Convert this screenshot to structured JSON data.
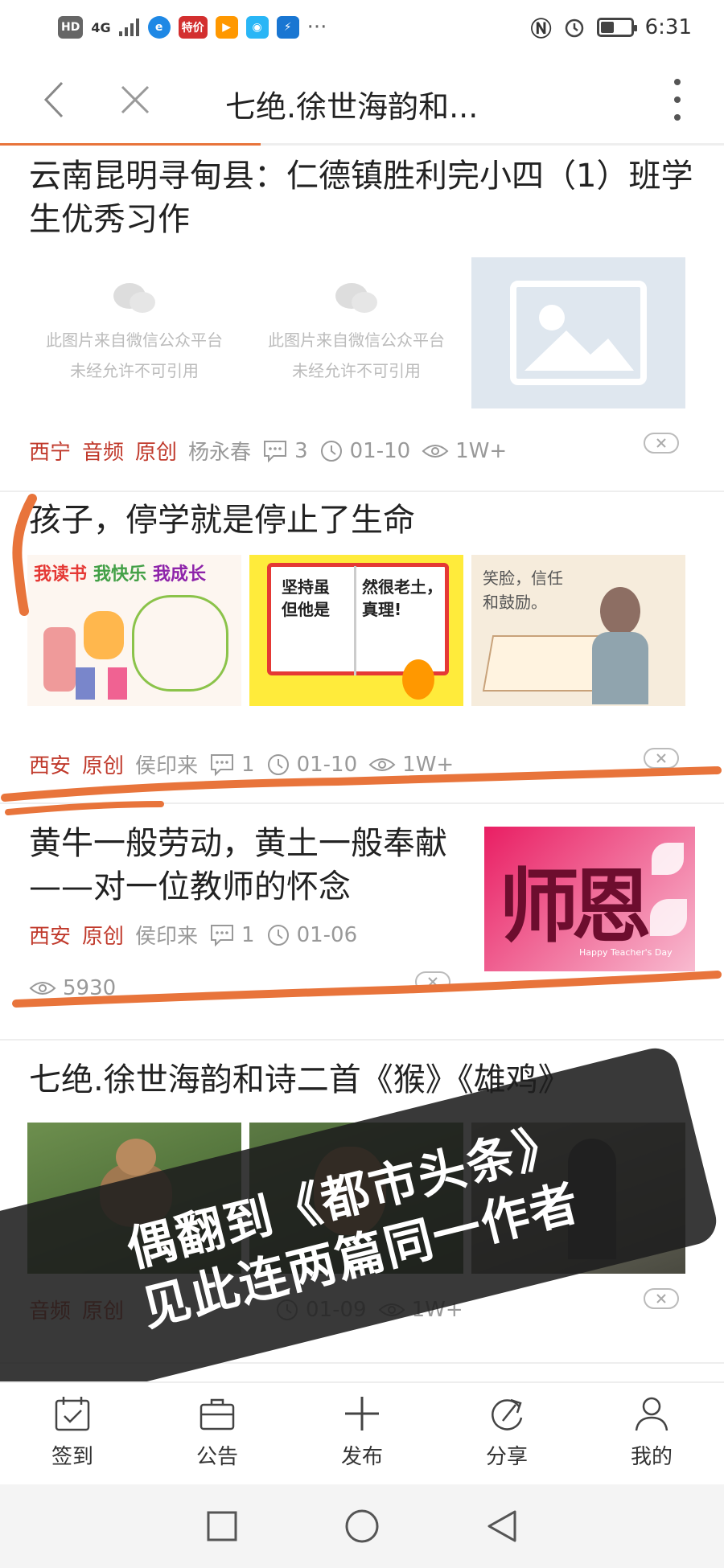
{
  "status_bar": {
    "hd": "HD",
    "signal": "4G",
    "app_badge": "特价",
    "more": "···",
    "time": "6:31"
  },
  "nav": {
    "title": "七绝.徐世海韵和..."
  },
  "articles": [
    {
      "title": "云南昆明寻甸县：仁德镇胜利完小四（1）班学生优秀习作",
      "tags": [
        "西宁",
        "音频",
        "原创"
      ],
      "author": "杨永春",
      "comments": "3",
      "date": "01-10",
      "views": "1W+",
      "wechat_notice_line1": "此图片来自微信公众平台",
      "wechat_notice_line2": "未经允许不可引用"
    },
    {
      "title": "孩子，停学就是停止了生命",
      "tags": [
        "西安",
        "原创"
      ],
      "author": "侯印来",
      "comments": "1",
      "date": "01-10",
      "views": "1W+",
      "thumb1_text": [
        "我读书",
        "我快乐",
        "我成长"
      ],
      "thumb2_text": [
        "坚持虽",
        "但他是",
        "然很老土，",
        "真理!"
      ],
      "thumb3_text": [
        "笑脸，信任",
        "和鼓励。"
      ]
    },
    {
      "title_line1": "黄牛一般劳动，黄土一般奉献",
      "title_line2": "——对一位教师的怀念",
      "tags": [
        "西安",
        "原创"
      ],
      "author": "侯印来",
      "comments": "1",
      "date": "01-06",
      "views": "5930",
      "thumb_char": "师恩",
      "thumb_small": "Happy Teacher's Day"
    },
    {
      "title": "七绝.徐世海韵和诗二首《猴》《雄鸡》",
      "tags": [
        "音频",
        "原创"
      ],
      "date": "01-09",
      "views": "1W+"
    }
  ],
  "overlay": {
    "line1": "偶翻到《都市头条》",
    "line2": "见此连两篇同一作者"
  },
  "tabs": [
    {
      "label": "签到",
      "icon": "calendar-check-icon"
    },
    {
      "label": "公告",
      "icon": "briefcase-icon"
    },
    {
      "label": "发布",
      "icon": "plus-icon"
    },
    {
      "label": "分享",
      "icon": "share-icon"
    },
    {
      "label": "我的",
      "icon": "user-icon"
    }
  ],
  "colors": {
    "tag_red": "#c0392b",
    "marker_orange": "#e8743b",
    "meta_gray": "#999999"
  }
}
